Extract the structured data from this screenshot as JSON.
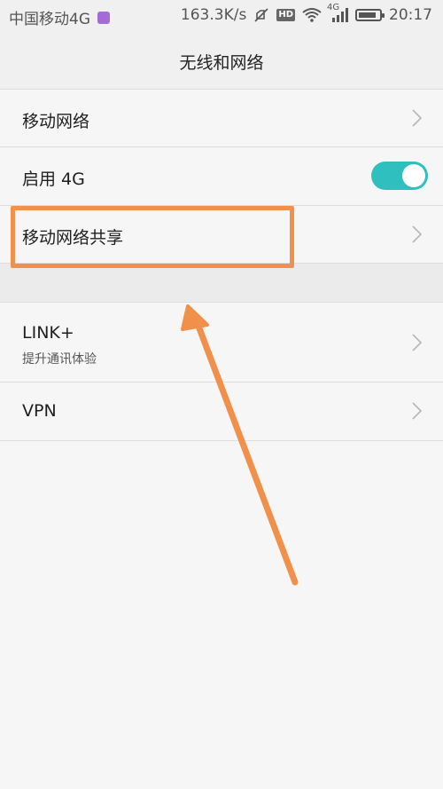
{
  "status_bar": {
    "carrier": "中国移动4G",
    "speed": "163.3K/s",
    "hd": "HD",
    "network": "4G",
    "time": "20:17",
    "battery_level": 0.85
  },
  "header": {
    "title": "无线和网络"
  },
  "items": [
    {
      "label": "移动网络"
    },
    {
      "label": "启用 4G",
      "toggle_on": true
    },
    {
      "label": "移动网络共享"
    },
    {
      "label": "LINK+",
      "subtitle": "提升通讯体验"
    },
    {
      "label": "VPN"
    }
  ],
  "colors": {
    "accent_toggle": "#2fbfbe",
    "annotation": "#f0904a"
  }
}
